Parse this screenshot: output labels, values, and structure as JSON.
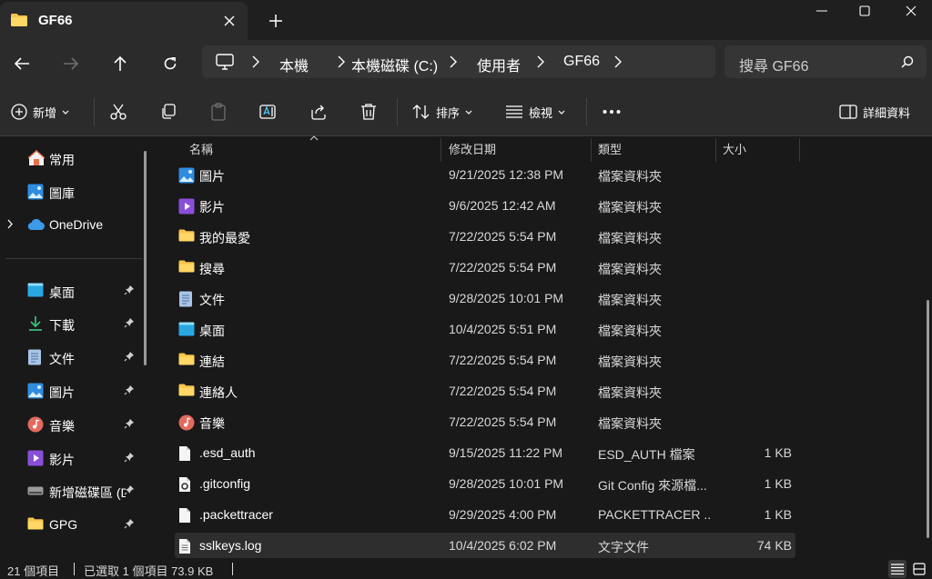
{
  "tab": {
    "title": "GF66"
  },
  "breadcrumb": [
    "本機",
    "本機磁碟 (C:)",
    "使用者",
    "GF66"
  ],
  "search": {
    "placeholder": "搜尋 GF66"
  },
  "toolbar": {
    "new_label": "新增",
    "sort_label": "排序",
    "view_label": "檢視",
    "details_label": "詳細資料"
  },
  "sidebar": {
    "top": [
      {
        "label": "常用",
        "icon": "home-icon"
      },
      {
        "label": "圖庫",
        "icon": "gallery-icon"
      },
      {
        "label": "OneDrive",
        "icon": "cloud-icon"
      }
    ],
    "pinned": [
      {
        "label": "桌面",
        "icon": "desktop-icon"
      },
      {
        "label": "下載",
        "icon": "download-icon"
      },
      {
        "label": "文件",
        "icon": "document-icon"
      },
      {
        "label": "圖片",
        "icon": "picture-icon"
      },
      {
        "label": "音樂",
        "icon": "music-icon"
      },
      {
        "label": "影片",
        "icon": "video-icon"
      },
      {
        "label": "新增磁碟區 (D:)",
        "icon": "drive-icon"
      },
      {
        "label": "GPG",
        "icon": "folder-icon"
      }
    ]
  },
  "columns": {
    "name": "名稱",
    "date": "修改日期",
    "type": "類型",
    "size": "大小"
  },
  "files": [
    {
      "name": "圖片",
      "date": "9/21/2025 12:38 PM",
      "type": "檔案資料夾",
      "size": "",
      "icon": "picture-icon"
    },
    {
      "name": "影片",
      "date": "9/6/2025 12:42 AM",
      "type": "檔案資料夾",
      "size": "",
      "icon": "video-icon"
    },
    {
      "name": "我的最愛",
      "date": "7/22/2025 5:54 PM",
      "type": "檔案資料夾",
      "size": "",
      "icon": "folder-icon"
    },
    {
      "name": "搜尋",
      "date": "7/22/2025 5:54 PM",
      "type": "檔案資料夾",
      "size": "",
      "icon": "folder-icon"
    },
    {
      "name": "文件",
      "date": "9/28/2025 10:01 PM",
      "type": "檔案資料夾",
      "size": "",
      "icon": "document-icon"
    },
    {
      "name": "桌面",
      "date": "10/4/2025 5:51 PM",
      "type": "檔案資料夾",
      "size": "",
      "icon": "desktop-icon"
    },
    {
      "name": "連結",
      "date": "7/22/2025 5:54 PM",
      "type": "檔案資料夾",
      "size": "",
      "icon": "folder-icon"
    },
    {
      "name": "連絡人",
      "date": "7/22/2025 5:54 PM",
      "type": "檔案資料夾",
      "size": "",
      "icon": "folder-icon"
    },
    {
      "name": "音樂",
      "date": "7/22/2025 5:54 PM",
      "type": "檔案資料夾",
      "size": "",
      "icon": "music-icon"
    },
    {
      "name": ".esd_auth",
      "date": "9/15/2025 11:22 PM",
      "type": "ESD_AUTH 檔案",
      "size": "1 KB",
      "icon": "file-icon"
    },
    {
      "name": ".gitconfig",
      "date": "9/28/2025 10:01 PM",
      "type": "Git Config 來源檔...",
      "size": "1 KB",
      "icon": "config-file-icon"
    },
    {
      "name": ".packettracer",
      "date": "9/29/2025 4:00 PM",
      "type": "PACKETTRACER ...",
      "size": "1 KB",
      "icon": "file-icon"
    },
    {
      "name": "sslkeys.log",
      "date": "10/4/2025 6:02 PM",
      "type": "文字文件",
      "size": "74 KB",
      "icon": "text-file-icon"
    }
  ],
  "status": {
    "count": "21 個項目",
    "selected": "已選取 1 個項目  73.9 KB"
  },
  "colors": {
    "accent": "#4cc2ff",
    "folder": "#f8c54a",
    "background": "#191919",
    "panel": "#2b2b2b"
  }
}
